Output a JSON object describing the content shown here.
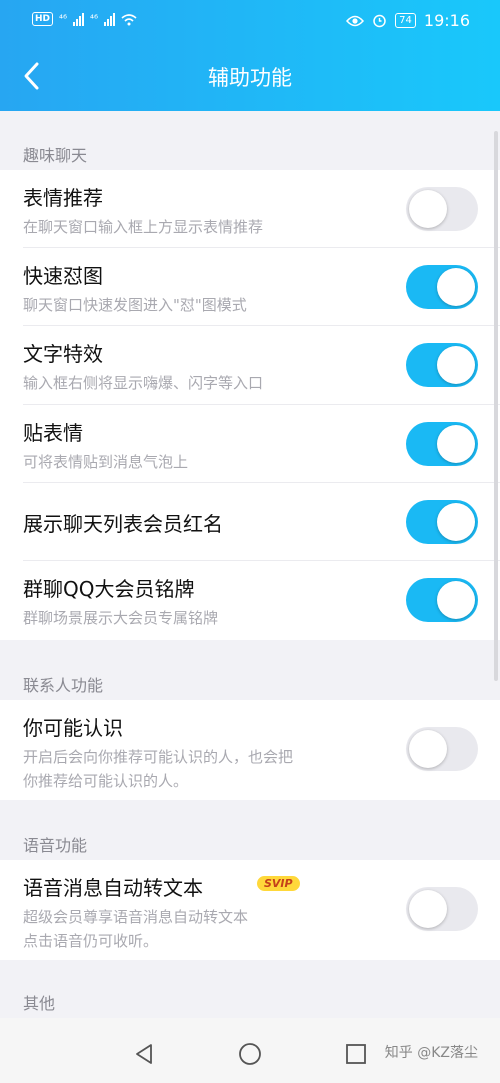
{
  "status_bar": {
    "hd": "HD",
    "sig1_label": "⁴⁶",
    "sig2_label": "⁴⁶",
    "battery": "74",
    "time": "19:16"
  },
  "header": {
    "title": "辅助功能"
  },
  "sections": [
    {
      "title": "趣味聊天",
      "items": [
        {
          "title": "表情推荐",
          "desc": "在聊天窗口输入框上方显示表情推荐",
          "enabled": false
        },
        {
          "title": "快速怼图",
          "desc": "聊天窗口快速发图进入\"怼\"图模式",
          "enabled": true
        },
        {
          "title": "文字特效",
          "desc": "输入框右侧将显示嗨爆、闪字等入口",
          "enabled": true
        },
        {
          "title": "贴表情",
          "desc": "可将表情贴到消息气泡上",
          "enabled": true
        },
        {
          "title": "展示聊天列表会员红名",
          "desc": "",
          "enabled": true
        },
        {
          "title": "群聊QQ大会员铭牌",
          "desc": "群聊场景展示大会员专属铭牌",
          "enabled": true
        }
      ]
    },
    {
      "title": "联系人功能",
      "items": [
        {
          "title": "你可能认识",
          "desc_line1": "开启后会向你推荐可能认识的人，也会把",
          "desc_line2": "你推荐给可能认识的人。",
          "enabled": false
        }
      ]
    },
    {
      "title": "语音功能",
      "items": [
        {
          "title": "语音消息自动转文本",
          "badge": "SVIP",
          "desc_line1": "超级会员尊享语音消息自动转文本",
          "desc_line2": "点击语音仍可收听。",
          "enabled": false
        }
      ]
    },
    {
      "title": "其他"
    }
  ],
  "nav_bar": {
    "watermark": "知乎 @KZ落尘"
  },
  "colors": {
    "accent": "#1ab9f4",
    "header_start": "#27a6f2",
    "header_end": "#19c8fb"
  }
}
